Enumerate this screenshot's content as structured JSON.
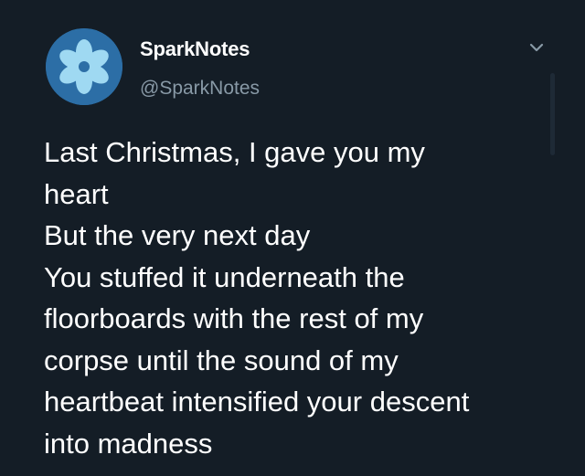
{
  "account": {
    "display_name": "SparkNotes",
    "handle": "@SparkNotes",
    "avatar_icon": "sparknotes-logo-icon",
    "avatar_color": "#2c6ea6"
  },
  "tweet": {
    "lines": [
      "Last Christmas, I gave you my",
      "heart",
      "But the very next day",
      "You stuffed it underneath the",
      "floorboards with the rest of my",
      "corpse until the sound of my",
      "heartbeat intensified your descent",
      "into madness"
    ]
  },
  "menu": {
    "icon": "chevron-down-icon"
  },
  "theme": {
    "background": "#141d26",
    "text": "#ffffff",
    "secondary_text": "#8899a6"
  }
}
